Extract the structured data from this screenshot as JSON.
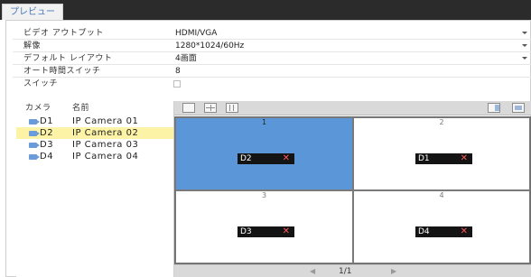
{
  "tabs": [
    {
      "label": "プレビュー"
    }
  ],
  "settings": {
    "video_output": {
      "label": "ビデオ アウトプット",
      "value": "HDMI/VGA"
    },
    "resolution": {
      "label": "解像",
      "value": "1280*1024/60Hz"
    },
    "default_layout": {
      "label": "デフォルト レイアウト",
      "value": "4画面"
    },
    "auto_switch_time": {
      "label": "オート時間スイッチ",
      "value": "8"
    },
    "switch": {
      "label": "スイッチ",
      "checked": false
    }
  },
  "camera_list": {
    "header_camera": "カメラ",
    "header_name": "名前",
    "selected_index": 1,
    "rows": [
      {
        "id": "D1",
        "name": "IP Camera 01"
      },
      {
        "id": "D2",
        "name": "IP Camera 02"
      },
      {
        "id": "D3",
        "name": "IP Camera 03"
      },
      {
        "id": "D4",
        "name": "IP Camera 04"
      }
    ]
  },
  "grid": {
    "active_cell": 1,
    "cells": [
      {
        "number": "1",
        "channel": "D2",
        "remove": "✕"
      },
      {
        "number": "2",
        "channel": "D1",
        "remove": "✕"
      },
      {
        "number": "3",
        "channel": "D3",
        "remove": "✕"
      },
      {
        "number": "4",
        "channel": "D4",
        "remove": "✕"
      }
    ]
  },
  "pager": {
    "prev": "◀",
    "next": "▶",
    "text": "1/1"
  },
  "colors": {
    "accent": "#5b96d9",
    "selected_row": "#fcf3a6",
    "topbar": "#2b2b2b",
    "remove": "#ff5a5a"
  }
}
